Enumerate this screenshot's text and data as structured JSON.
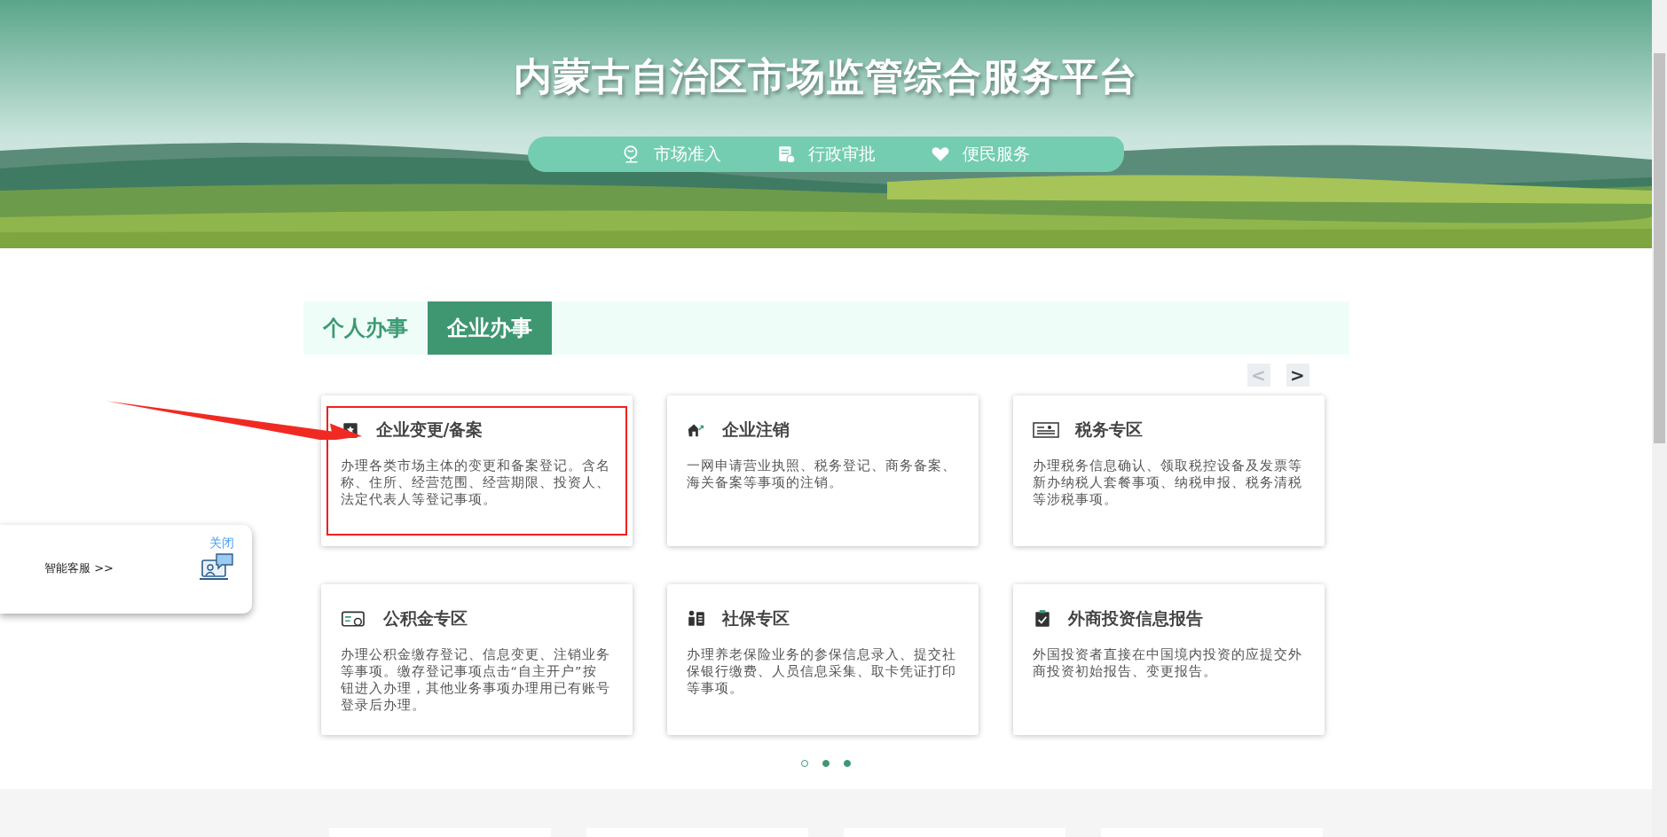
{
  "header": {
    "title": "内蒙古自治区市场监管综合服务平台",
    "nav": [
      {
        "label": "市场准入",
        "kind": "market"
      },
      {
        "label": "行政审批",
        "kind": "approval"
      },
      {
        "label": "便民服务",
        "kind": "service"
      }
    ]
  },
  "tabs": [
    {
      "label": "个人办事",
      "selected": false
    },
    {
      "label": "企业办事",
      "selected": true
    }
  ],
  "pager": {
    "prev": "<",
    "next": ">",
    "prev_disabled": true
  },
  "cards": [
    {
      "title": "企业变更/备案",
      "description": "办理各类市场主体的变更和备案登记。含名称、住所、经营范围、经营期限、投资人、法定代表人等登记事项。",
      "kind": "badge",
      "highlighted": true
    },
    {
      "title": "企业注销",
      "description": "一网申请营业执照、税务登记、商务备案、海关备案等事项的注销。",
      "kind": "house",
      "highlighted": false
    },
    {
      "title": "税务专区",
      "description": "办理税务信息确认、领取税控设备及发票等新办纳税人套餐事项、纳税申报、税务清税等涉税事项。",
      "kind": "certificate",
      "highlighted": false
    },
    {
      "title": "公积金专区",
      "description": "办理公积金缴存登记、信息变更、注销业务等事项。缴存登记事项点击“自主开户”按钮进入办理，其他业务事项办理用已有账号登录后办理。",
      "kind": "card",
      "highlighted": false
    },
    {
      "title": "社保专区",
      "description": "办理养老保险业务的参保信息录入、提交社保银行缴费、人员信息采集、取卡凭证打印等事项。",
      "kind": "person",
      "highlighted": false
    },
    {
      "title": "外商投资信息报告",
      "description": "外国投资者直接在中国境内投资的应提交外商投资初始报告、变更报告。",
      "kind": "clipboard",
      "highlighted": false
    }
  ],
  "dots": [
    {
      "selected": false
    },
    {
      "selected": true
    },
    {
      "selected": true
    }
  ],
  "assistant": {
    "close": "关闭",
    "label": "智能客服 >>"
  }
}
